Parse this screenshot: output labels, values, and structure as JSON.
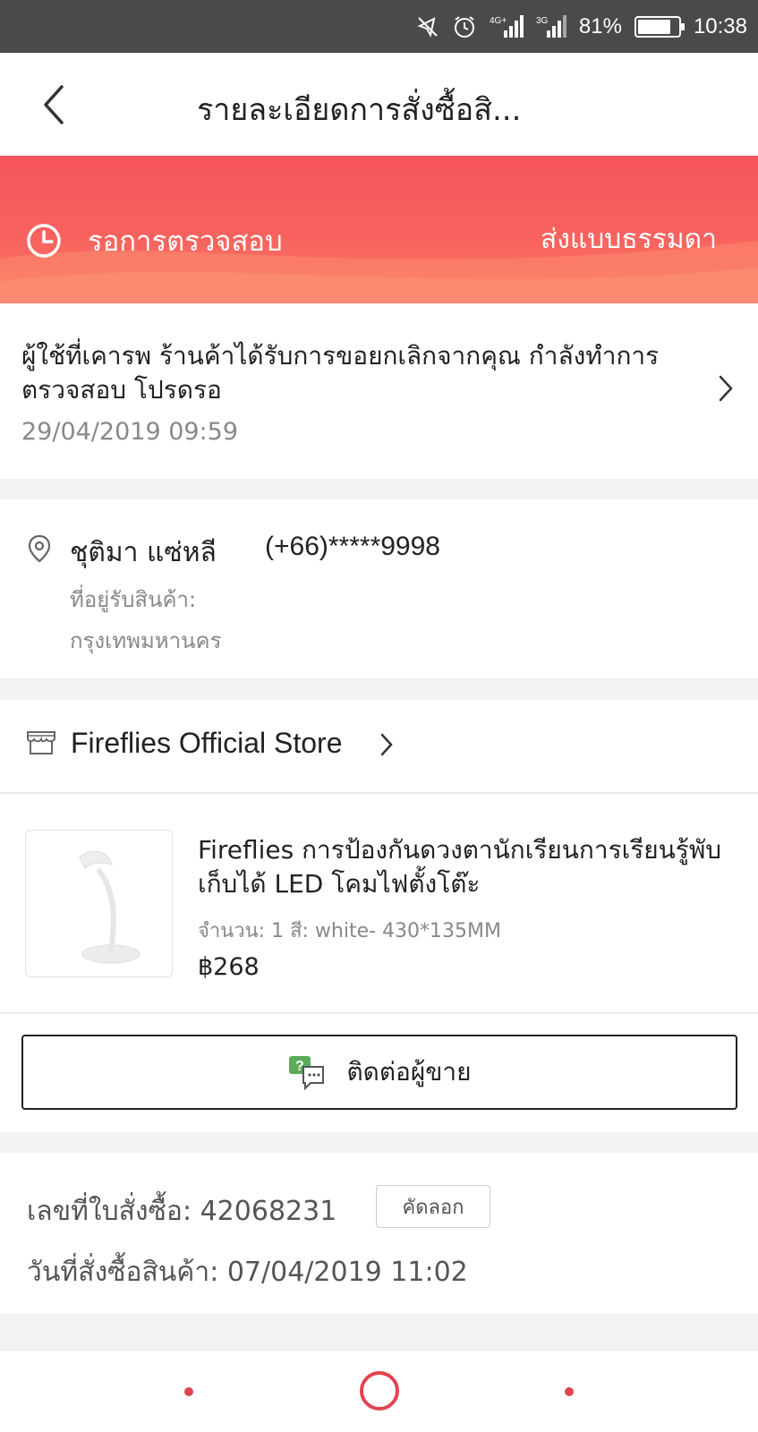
{
  "status_bar": {
    "battery": "81%",
    "battery_level": 0.81,
    "time": "10:38",
    "network_1": "4G+",
    "network_2": "3G",
    "icons": [
      "mute-icon",
      "alarm-icon",
      "signal-4g-icon",
      "signal-3g-icon",
      "battery-icon"
    ]
  },
  "header": {
    "title": "รายละเอียดการสั่งซื้อสิ..."
  },
  "banner": {
    "status": "รอการตรวจสอบ",
    "shipping": "ส่งแบบธรรมดา"
  },
  "message": {
    "text": "ผู้ใช้ที่เคารพ ร้านค้าได้รับการขอยกเลิกจากคุณ กำลังทำการตรวจสอบ โปรดรอ",
    "time": "29/04/2019 09:59"
  },
  "address": {
    "name": "ชุติมา แซ่หลี",
    "phone": "(+66)*****9998",
    "label": "ที่อยู่รับสินค้า:",
    "city": "กรุงเทพมหานคร"
  },
  "store": {
    "name": "Fireflies Official Store"
  },
  "product": {
    "name": "Fireflies การป้องกันดวงตานักเรียนการเรียนรู้พับเก็บได้ LED โคมไฟตั้งโต๊ะ",
    "attributes": "จำนวน: 1 สี: white- 430*135MM",
    "price": "฿268"
  },
  "contact": {
    "label": "ติดต่อผู้ขาย"
  },
  "order": {
    "number_label": "เลขที่ใบสั่งซื้อ: 42068231",
    "copy_label": "คัดลอก",
    "date_label": "วันที่สั่งซื้อสินค้า: 07/04/2019 11:02"
  },
  "colors": {
    "accent": "#f6545e",
    "nav": "#e34350"
  }
}
